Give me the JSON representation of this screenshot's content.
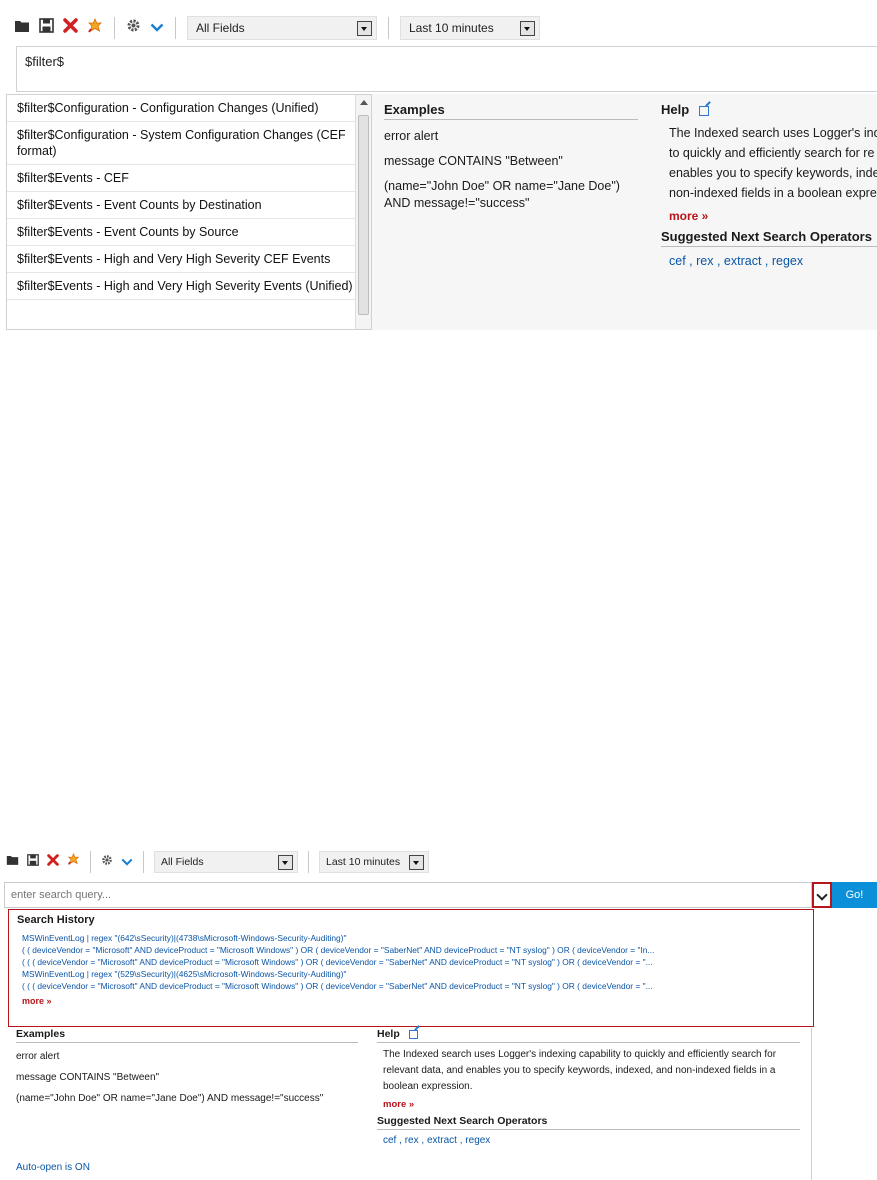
{
  "toolbar": {
    "icons": [
      "folder-icon",
      "save-icon",
      "delete-icon",
      "clear-icon",
      "gear-icon",
      "chevron-down-icon"
    ],
    "field_select": "All Fields",
    "time_select": "Last 10 minutes"
  },
  "panel1": {
    "search_value": "$filter$",
    "suggestions": [
      "$filter$Configuration - Configuration Changes (Unified)",
      "$filter$Configuration - System Configuration Changes (CEF format)",
      "$filter$Events - CEF",
      "$filter$Events - Event Counts by Destination",
      "$filter$Events - Event Counts by Source",
      "$filter$Events - High and Very High Severity CEF Events",
      "$filter$Events - High and Very High Severity Events (Unified)"
    ],
    "help_text_lines": [
      "The Indexed search uses Logger's ind",
      "to quickly and efficiently search for re",
      "enables you to specify keywords, inde",
      "non-indexed fields in a boolean expre"
    ]
  },
  "examples": {
    "title": "Examples",
    "items": [
      "error alert",
      "message CONTAINS \"Between\"",
      "(name=\"John Doe\" OR name=\"Jane Doe\") AND message!=\"success\""
    ]
  },
  "help": {
    "title": "Help",
    "text": "The Indexed search uses Logger's indexing capability to quickly and efficiently search for relevant data, and enables you to specify keywords, indexed, and non-indexed fields in a boolean expression.",
    "more": "more »",
    "suggested_title": "Suggested Next Search Operators",
    "operators": [
      "cef",
      "rex",
      "extract",
      "regex"
    ],
    "separator": " , "
  },
  "panel2": {
    "search_placeholder": "enter search query...",
    "go_label": "Go!",
    "history_title": "Search History",
    "history": [
      "MSWinEventLog | regex \"(642\\sSecurity)|(4738\\sMicrosoft-Windows-Security-Auditing)\"",
      "( ( deviceVendor = \"Microsoft\" AND deviceProduct = \"Microsoft Windows\" ) OR ( deviceVendor = \"SaberNet\" AND deviceProduct = \"NT syslog\" ) OR ( deviceVendor = \"In...",
      "( ( ( deviceVendor = \"Microsoft\" AND deviceProduct = \"Microsoft Windows\" ) OR ( deviceVendor = \"SaberNet\" AND deviceProduct = \"NT syslog\" ) OR ( deviceVendor = \"...",
      "MSWinEventLog | regex \"(529\\sSecurity)|(4625\\sMicrosoft-Windows-Security-Auditing)\"",
      "( ( ( deviceVendor = \"Microsoft\" AND deviceProduct = \"Microsoft Windows\" ) OR ( deviceVendor = \"SaberNet\" AND deviceProduct = \"NT syslog\" ) OR ( deviceVendor = \"..."
    ],
    "history_more": "more »",
    "auto_open": "Auto-open is ON"
  },
  "colors": {
    "accent_red": "#b5161b",
    "link_blue": "#0a55a6",
    "go_blue": "#0a8fd8"
  }
}
